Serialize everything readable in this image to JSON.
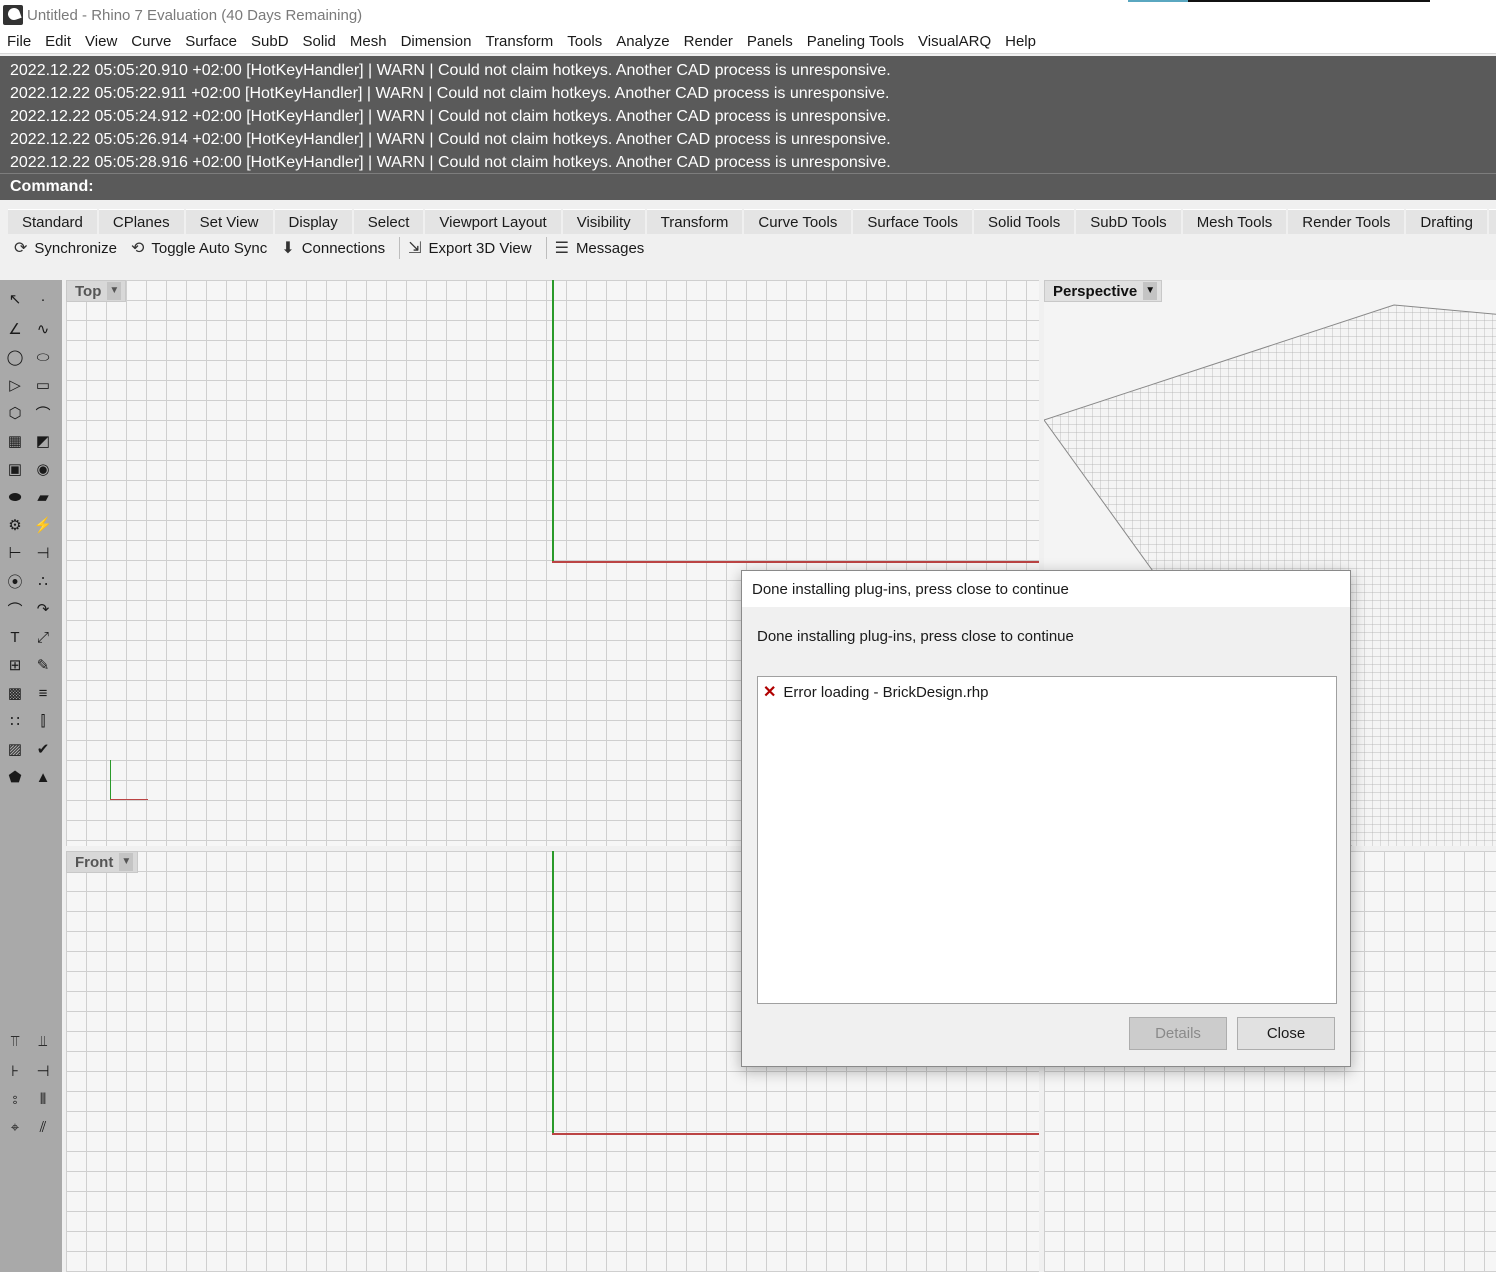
{
  "window": {
    "title": "Untitled - Rhino 7 Evaluation (40 Days Remaining)"
  },
  "menu": [
    "File",
    "Edit",
    "View",
    "Curve",
    "Surface",
    "SubD",
    "Solid",
    "Mesh",
    "Dimension",
    "Transform",
    "Tools",
    "Analyze",
    "Render",
    "Panels",
    "Paneling Tools",
    "VisualARQ",
    "Help"
  ],
  "history": [
    "2022.12.22 05:05:20.910 +02:00 [HotKeyHandler] | WARN | Could not claim hotkeys. Another CAD process is unresponsive.",
    "2022.12.22 05:05:22.911 +02:00 [HotKeyHandler] | WARN | Could not claim hotkeys. Another CAD process is unresponsive.",
    "2022.12.22 05:05:24.912 +02:00 [HotKeyHandler] | WARN | Could not claim hotkeys. Another CAD process is unresponsive.",
    "2022.12.22 05:05:26.914 +02:00 [HotKeyHandler] | WARN | Could not claim hotkeys. Another CAD process is unresponsive.",
    "2022.12.22 05:05:28.916 +02:00 [HotKeyHandler] | WARN | Could not claim hotkeys. Another CAD process is unresponsive."
  ],
  "command": {
    "label": "Command:"
  },
  "tabs": [
    "Standard",
    "CPlanes",
    "Set View",
    "Display",
    "Select",
    "Viewport Layout",
    "Visibility",
    "Transform",
    "Curve Tools",
    "Surface Tools",
    "Solid Tools",
    "SubD Tools",
    "Mesh Tools",
    "Render Tools",
    "Drafting",
    "N"
  ],
  "toolbar": {
    "synchronize": "Synchronize",
    "toggle_auto_sync": "Toggle Auto Sync",
    "connections": "Connections",
    "export_3d_view": "Export 3D View",
    "messages": "Messages"
  },
  "viewports": {
    "top": "Top",
    "perspective": "Perspective",
    "front": "Front"
  },
  "dialog": {
    "title": "Done installing plug-ins, press close to continue",
    "message": "Done installing plug-ins, press close to continue",
    "items": [
      "Error loading - BrickDesign.rhp"
    ],
    "details_label": "Details",
    "close_label": "Close"
  }
}
